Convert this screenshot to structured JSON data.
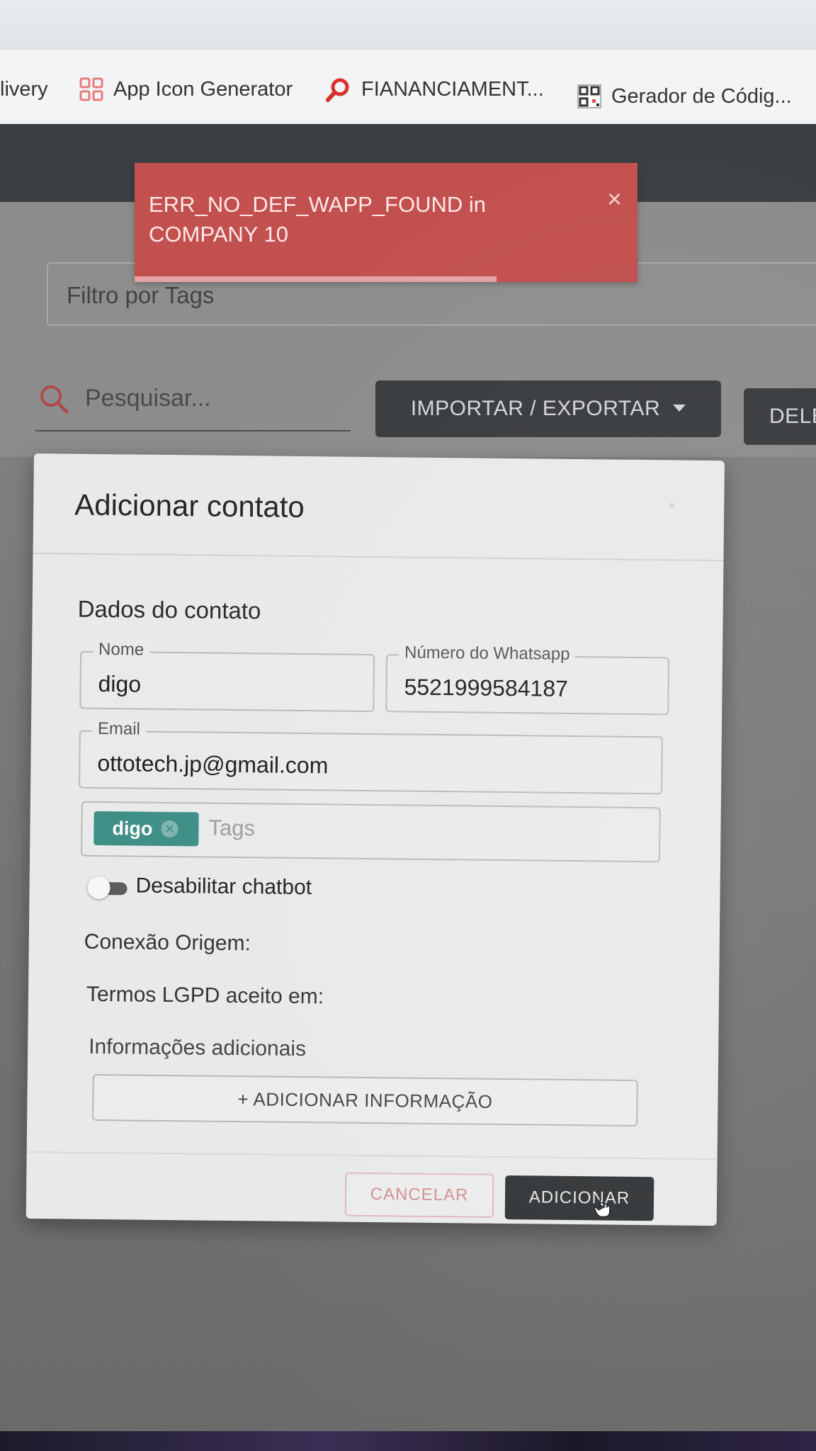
{
  "bookmarks": [
    {
      "label": "livery",
      "icon": "none"
    },
    {
      "label": "App Icon Generator",
      "icon": "grid-icon"
    },
    {
      "label": "FIANANCIAMENT...",
      "icon": "search-brand-icon"
    },
    {
      "label": "Gerador de Códig...",
      "icon": "qr-code-icon"
    }
  ],
  "toast": {
    "line1": "ERR_NO_DEF_WAPP_FOUND in",
    "line2": "COMPANY 10",
    "close": "×",
    "progress_fraction": 0.72,
    "color": "#c2504f"
  },
  "filters": {
    "tags_placeholder": "Filtro por Tags",
    "search_placeholder": "Pesquisar...",
    "import_export_label": "IMPORTAR / EXPORTAR",
    "delete_label": "DELE"
  },
  "modal": {
    "title": "Adicionar contato",
    "section_title": "Dados do contato",
    "name": {
      "label": "Nome",
      "value": "digo"
    },
    "whatsapp": {
      "label": "Número do Whatsapp",
      "value": "5521999584187"
    },
    "email": {
      "label": "Email",
      "value": "ottotech.jp@gmail.com"
    },
    "tags": {
      "chips": [
        "digo"
      ],
      "placeholder": "Tags",
      "chip_color": "#3f8f87"
    },
    "disable_chatbot_label": "Desabilitar chatbot",
    "disable_chatbot_on": false,
    "origin_connection_label": "Conexão Origem:",
    "lgpd_label": "Termos LGPD aceito em:",
    "additional_info_label": "Informações adicionais",
    "add_info_button": "+ ADICIONAR INFORMAÇÃO",
    "cancel_button": "CANCELAR",
    "submit_button": "ADICIONAR"
  },
  "colors": {
    "header_bg": "#3b3f42",
    "primary_button": "#313436",
    "cancel_text": "#d08f8f"
  }
}
